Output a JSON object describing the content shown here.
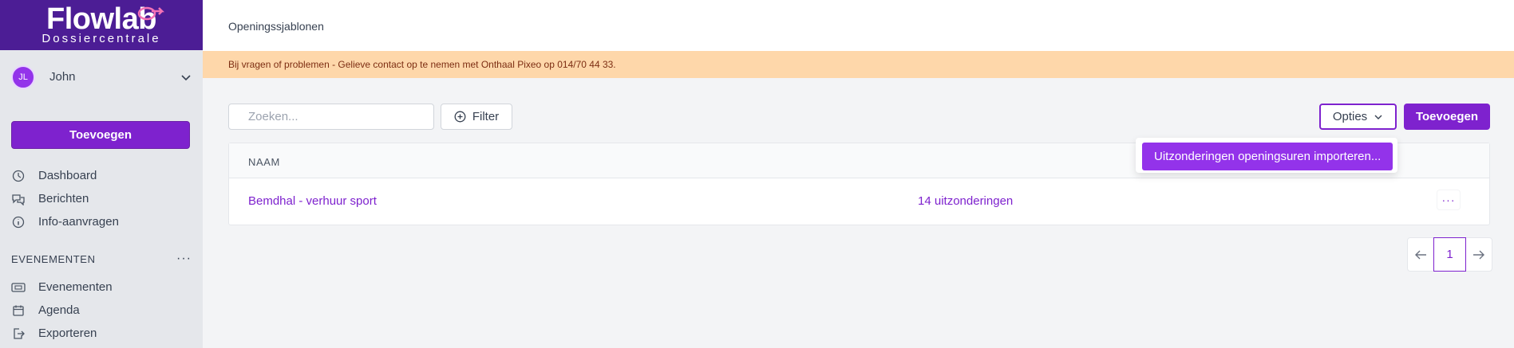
{
  "brand": {
    "name": "Flowlab",
    "subtitle": "Dossiercentrale",
    "bg_color": "#4c1d95",
    "accent": "#7e22ce"
  },
  "user": {
    "initials": "JL",
    "name": "John"
  },
  "sidebar": {
    "add_label": "Toevoegen",
    "items": [
      {
        "label": "Dashboard",
        "icon": "dashboard-icon"
      },
      {
        "label": "Berichten",
        "icon": "chat-icon"
      },
      {
        "label": "Info-aanvragen",
        "icon": "info-icon"
      }
    ],
    "section_title": "EVENEMENTEN",
    "section_items": [
      {
        "label": "Evenementen",
        "icon": "ticket-icon"
      },
      {
        "label": "Agenda",
        "icon": "calendar-icon"
      },
      {
        "label": "Exporteren",
        "icon": "export-icon"
      }
    ]
  },
  "header": {
    "breadcrumb": "Openingssjablonen"
  },
  "notice": {
    "text": "Bij vragen of problemen - Gelieve contact op te nemen met Onthaal Pixeo op 014/70 44 33.",
    "bg_color": "#fed7aa"
  },
  "toolbar": {
    "search_placeholder": "Zoeken...",
    "filter_label": "Filter",
    "options_label": "Opties",
    "add_label": "Toevoegen"
  },
  "dropdown": {
    "items": [
      "Uitzonderingen openingsuren importeren..."
    ]
  },
  "table": {
    "columns": [
      "NAAM"
    ],
    "rows": [
      {
        "name": "Bemdhal - verhuur sport",
        "exceptions": "14 uitzonderingen",
        "menu": "···"
      }
    ]
  },
  "pagination": {
    "current_page": "1"
  }
}
